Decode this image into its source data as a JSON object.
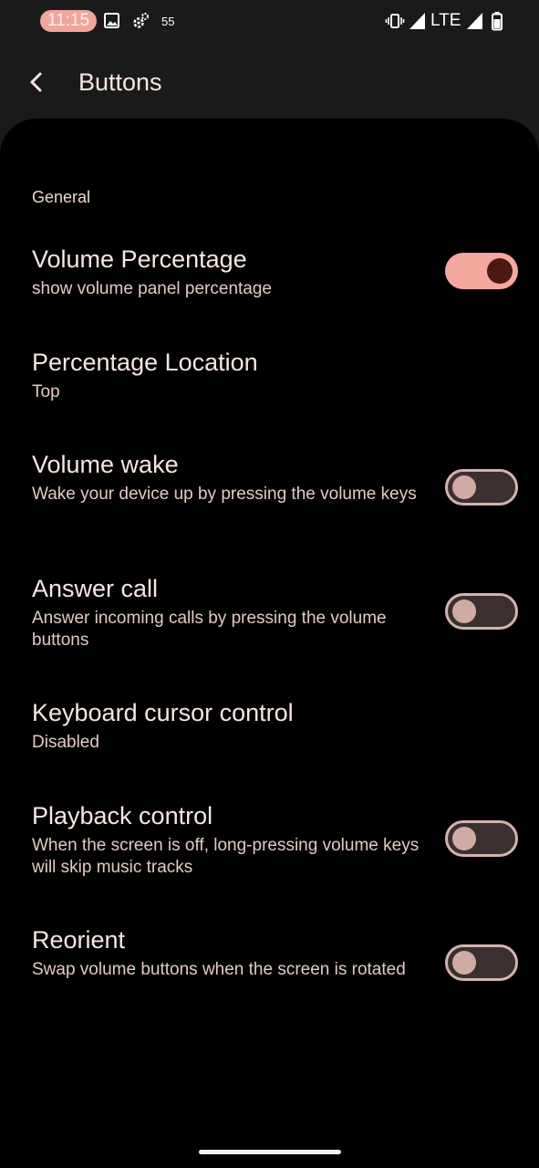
{
  "status_bar": {
    "time": "11:15",
    "notification_count": "55",
    "network": "LTE",
    "icons": [
      "image-icon",
      "settings-gear-icon",
      "vibrate-icon",
      "signal-icon",
      "signal-icon",
      "battery-icon"
    ]
  },
  "app_bar": {
    "title": "Buttons",
    "back_icon": "chevron-left-icon"
  },
  "section": {
    "header": "General"
  },
  "settings": [
    {
      "title": "Volume Percentage",
      "summary": "show volume panel percentage",
      "toggle": true
    },
    {
      "title": "Percentage Location",
      "summary": "Top",
      "toggle": null
    },
    {
      "title": "Volume wake",
      "summary": "Wake your device up by pressing the volume keys",
      "toggle": false
    },
    {
      "title": "Answer call",
      "summary": "Answer incoming calls by pressing the volume buttons",
      "toggle": false
    },
    {
      "title": "Keyboard cursor control",
      "summary": "Disabled",
      "toggle": null
    },
    {
      "title": "Playback control",
      "summary": "When the screen is off, long-pressing volume keys will skip music tracks",
      "toggle": false
    },
    {
      "title": "Reorient",
      "summary": "Swap volume buttons when the screen is rotated",
      "toggle": false
    }
  ],
  "colors": {
    "accent": "#f5a89f",
    "knob_on": "#4a1914",
    "background": "#000000",
    "appbar": "#1b1a1a"
  }
}
